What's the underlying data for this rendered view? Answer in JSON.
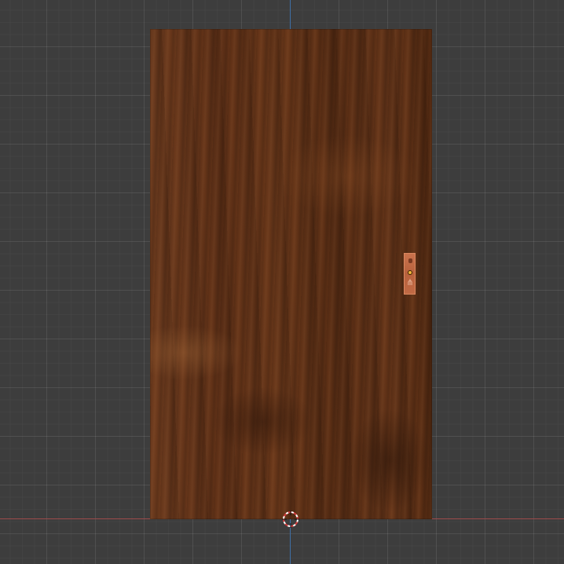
{
  "viewport": {
    "background_color": "#3d3d3d",
    "x_axis_color": "#9c4b4b",
    "y_axis_color": "#3f6fa6"
  },
  "scene": {
    "door": {
      "material": "dark wood",
      "color": "#5b2f17"
    },
    "handle": {
      "color": "#c06a45",
      "selected": true,
      "origin_color": "#f2b53a"
    }
  },
  "icons": {
    "cursor": "3d-cursor-icon",
    "handle_mark": "⋔"
  }
}
